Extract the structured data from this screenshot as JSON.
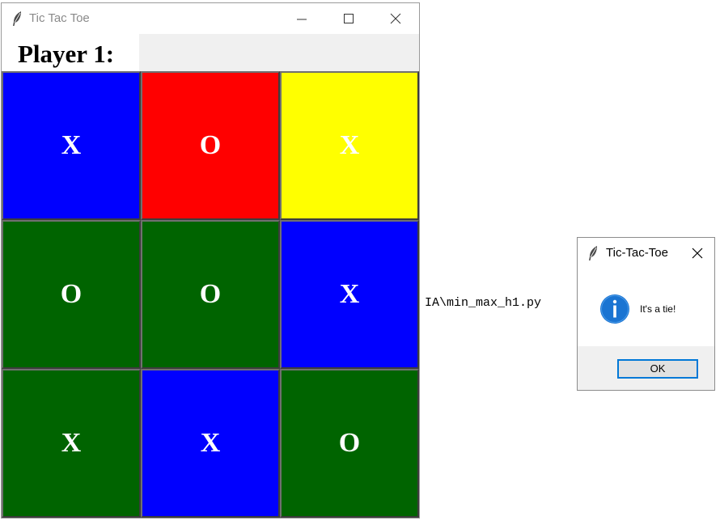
{
  "main_window": {
    "title": "Tic Tac Toe",
    "icon": "feather-icon",
    "controls": {
      "minimize_icon": "minimize-icon",
      "maximize_icon": "maximize-icon",
      "close_icon": "close-icon"
    }
  },
  "player_label": "Player 1:",
  "board": {
    "cells": [
      {
        "mark": "X",
        "color": "#0000ff"
      },
      {
        "mark": "O",
        "color": "#ff0000"
      },
      {
        "mark": "X",
        "color": "#ffff00"
      },
      {
        "mark": "O",
        "color": "#006400"
      },
      {
        "mark": "O",
        "color": "#006400"
      },
      {
        "mark": "X",
        "color": "#0000ff"
      },
      {
        "mark": "X",
        "color": "#006400"
      },
      {
        "mark": "X",
        "color": "#0000ff"
      },
      {
        "mark": "O",
        "color": "#006400"
      }
    ]
  },
  "background_text": "IA\\min_max_h1.py",
  "dialog": {
    "title": "Tic-Tac-Toe",
    "icon": "feather-icon",
    "info_icon": "info-icon",
    "message": "It's a tie!",
    "ok_label": "OK",
    "accent_color": "#0078d7"
  }
}
